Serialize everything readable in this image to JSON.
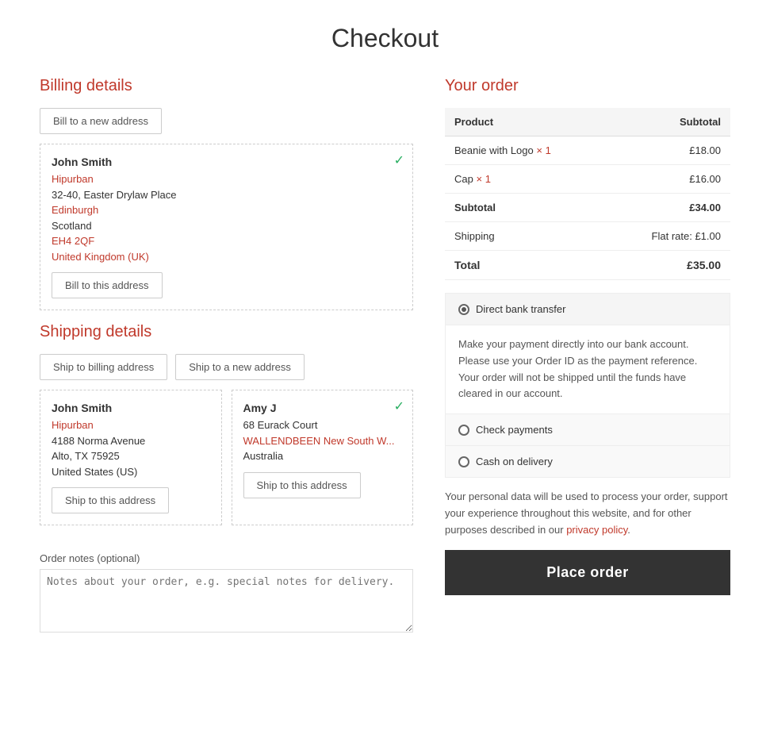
{
  "page": {
    "title": "Checkout"
  },
  "billing": {
    "section_title": "Billing details",
    "new_address_btn": "Bill to a new address",
    "saved_address": {
      "name": "John Smith",
      "company": "Hipurban",
      "street": "32-40, Easter Drylaw Place",
      "city": "Edinburgh",
      "region": "Scotland",
      "postcode": "EH4 2QF",
      "country": "United Kingdom (UK)",
      "selected": true
    },
    "bill_to_btn": "Bill to this address"
  },
  "shipping": {
    "section_title": "Shipping details",
    "ship_to_billing_btn": "Ship to billing address",
    "new_address_btn": "Ship to a new address",
    "addresses": [
      {
        "name": "John Smith",
        "company": "Hipurban",
        "street": "4188 Norma Avenue",
        "city_state": "Alto, TX 75925",
        "country": "United States (US)",
        "selected": false,
        "ship_btn": "Ship to this address"
      },
      {
        "name": "Amy J",
        "company": "",
        "street": "68 Eurack Court",
        "city_state": "WALLENDBEEN New South W...",
        "country": "Australia",
        "selected": true,
        "ship_btn": "Ship to this address"
      }
    ]
  },
  "order_notes": {
    "label": "Order notes (optional)",
    "placeholder": "Notes about your order, e.g. special notes for delivery."
  },
  "your_order": {
    "title": "Your order",
    "columns": [
      "Product",
      "Subtotal"
    ],
    "items": [
      {
        "name": "Beanie with Logo",
        "qty": "× 1",
        "price": "£18.00"
      },
      {
        "name": "Cap",
        "qty": "× 1",
        "price": "£16.00"
      }
    ],
    "subtotal_label": "Subtotal",
    "subtotal_value": "£34.00",
    "shipping_label": "Shipping",
    "shipping_value": "Flat rate: £1.00",
    "total_label": "Total",
    "total_value": "£35.00"
  },
  "payment": {
    "options": [
      {
        "id": "direct-bank",
        "label": "Direct bank transfer",
        "active": true,
        "radio_filled": true,
        "description": "Make your payment directly into our bank account. Please use your Order ID as the payment reference. Your order will not be shipped until the funds have cleared in our account."
      },
      {
        "id": "check",
        "label": "Check payments",
        "active": false,
        "radio_filled": false,
        "description": ""
      },
      {
        "id": "cod",
        "label": "Cash on delivery",
        "active": false,
        "radio_filled": false,
        "description": ""
      }
    ],
    "privacy_text": "Your personal data will be used to process your order, support your experience throughout this website, and for other purposes described in our ",
    "privacy_link": "privacy policy",
    "privacy_end": ".",
    "place_order_btn": "Place order"
  }
}
